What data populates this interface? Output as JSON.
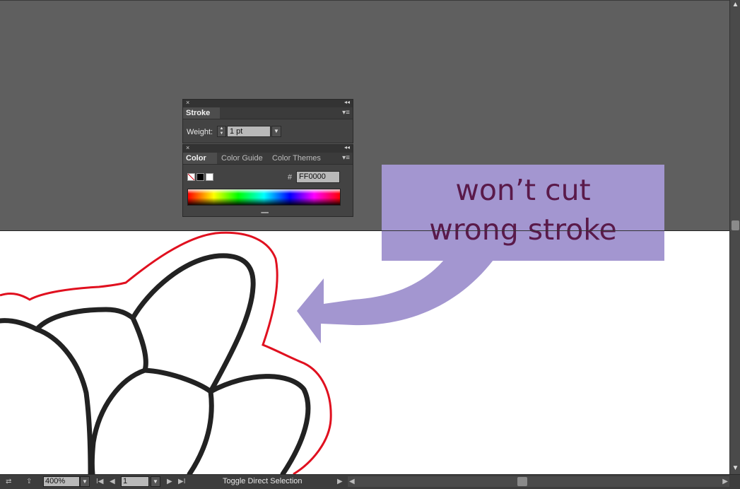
{
  "stroke_panel": {
    "tab": "Stroke",
    "weight_label": "Weight:",
    "weight_value": "1 pt"
  },
  "color_panel": {
    "tabs": [
      "Color",
      "Color Guide",
      "Color Themes"
    ],
    "hash_label": "#",
    "hex_value": "FF0000"
  },
  "callout": {
    "line1": "won’t cut",
    "line2": "wrong stroke",
    "color": "#a396d0",
    "text_color": "#5a1a4a"
  },
  "status_bar": {
    "zoom": "400%",
    "page": "1",
    "status_text": "Toggle Direct Selection"
  },
  "icons": {
    "close": "×",
    "collapse": "◂◂",
    "menu": "▾≡",
    "dropdown": "▼",
    "stepper_up": "▲",
    "stepper_down": "▼",
    "first": "I◀",
    "prev": "◀",
    "next": "▶",
    "last": "▶I",
    "scroll_left": "◀",
    "scroll_right": "▶",
    "scroll_up": "▲",
    "scroll_down": "▼"
  },
  "colors": {
    "cut_stroke": "#e0101f",
    "art_stroke": "#222222",
    "pasteboard": "#5f5f5f"
  }
}
